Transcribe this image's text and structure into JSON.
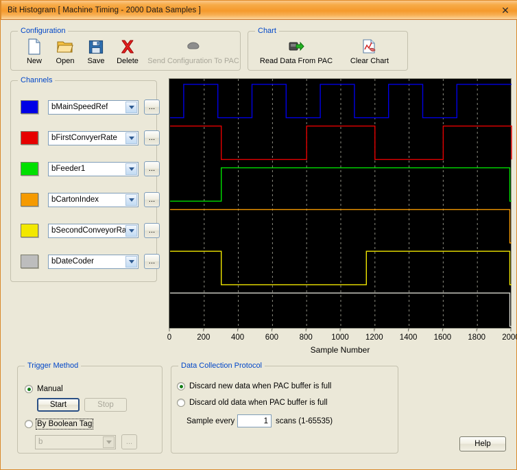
{
  "window": {
    "title": "Bit Histogram [ Machine Timing - 2000 Data Samples ]",
    "close_label": "✕"
  },
  "configuration": {
    "legend": "Configuration",
    "buttons": [
      {
        "label": "New",
        "icon": "new-document-icon",
        "enabled": true
      },
      {
        "label": "Open",
        "icon": "open-folder-icon",
        "enabled": true
      },
      {
        "label": "Save",
        "icon": "floppy-disk-icon",
        "enabled": true
      },
      {
        "label": "Delete",
        "icon": "red-x-icon",
        "enabled": true
      },
      {
        "label": "Send Configuration To PAC",
        "icon": "pac-device-icon",
        "enabled": false
      }
    ]
  },
  "chart_panel": {
    "legend": "Chart",
    "buttons": [
      {
        "label": "Read Data From PAC",
        "icon": "download-arrow-icon",
        "enabled": true
      },
      {
        "label": "Clear Chart",
        "icon": "clear-chart-icon",
        "enabled": true
      }
    ]
  },
  "channels": {
    "legend": "Channels",
    "browse_label": "...",
    "rows": [
      {
        "color": "#0000e6",
        "tag": "bMainSpeedRef"
      },
      {
        "color": "#e60000",
        "tag": "bFirstConvyerRate"
      },
      {
        "color": "#00e000",
        "tag": "bFeeder1"
      },
      {
        "color": "#f59a00",
        "tag": "bCartonIndex"
      },
      {
        "color": "#f2e800",
        "tag": "bSecondConveyorRat‹"
      },
      {
        "color": "#bdbdbd",
        "tag": "bDateCoder"
      }
    ]
  },
  "trigger": {
    "legend": "Trigger Method",
    "manual_label": "Manual",
    "manual_selected": true,
    "start_label": "Start",
    "stop_label": "Stop",
    "stop_enabled": false,
    "boolean_label": "By Boolean Tag",
    "boolean_selected": false,
    "tag_value": "b",
    "browse_label": "..."
  },
  "protocol": {
    "legend": "Data Collection Protocol",
    "discard_new_label": "Discard new data when PAC buffer is full",
    "discard_new_selected": true,
    "discard_old_label": "Discard old data when PAC buffer is full",
    "discard_old_selected": false,
    "sample_prefix": "Sample every",
    "sample_value": "1",
    "sample_suffix": "scans (1-65535)"
  },
  "help": {
    "label": "Help"
  },
  "chart_data": {
    "type": "line",
    "title": "",
    "xlabel": "Sample Number",
    "ylabel": "",
    "xlim": [
      0,
      2000
    ],
    "xticks": [
      0,
      200,
      400,
      600,
      800,
      1000,
      1200,
      1400,
      1600,
      1800,
      2000
    ],
    "xticklabels": [
      "0",
      "200",
      "400",
      "600",
      "800",
      "1000",
      "1200",
      "1400",
      "1600",
      "1800",
      "2000"
    ],
    "grid": true,
    "grid_style": "dashed-vertical",
    "background": "#000000",
    "legend_position": "none",
    "series": [
      {
        "name": "bMainSpeedRef",
        "color": "#0000e6",
        "lane": 0,
        "type": "digital",
        "transitions": [
          {
            "x": 0,
            "v": 0
          },
          {
            "x": 80,
            "v": 1
          },
          {
            "x": 280,
            "v": 0
          },
          {
            "x": 480,
            "v": 1
          },
          {
            "x": 680,
            "v": 0
          },
          {
            "x": 880,
            "v": 1
          },
          {
            "x": 1080,
            "v": 0
          },
          {
            "x": 1280,
            "v": 1
          },
          {
            "x": 1480,
            "v": 0
          },
          {
            "x": 1680,
            "v": 1
          },
          {
            "x": 2000,
            "v": 1
          }
        ]
      },
      {
        "name": "bFirstConvyerRate",
        "color": "#e60000",
        "lane": 1,
        "type": "digital",
        "transitions": [
          {
            "x": 0,
            "v": 1
          },
          {
            "x": 300,
            "v": 0
          },
          {
            "x": 800,
            "v": 1
          },
          {
            "x": 1200,
            "v": 0
          },
          {
            "x": 1600,
            "v": 1
          },
          {
            "x": 2000,
            "v": 0
          }
        ]
      },
      {
        "name": "bFeeder1",
        "color": "#00e000",
        "lane": 2,
        "type": "digital",
        "transitions": [
          {
            "x": 0,
            "v": 0
          },
          {
            "x": 300,
            "v": 1
          },
          {
            "x": 1990,
            "v": 0
          }
        ]
      },
      {
        "name": "bCartonIndex",
        "color": "#f59a00",
        "lane": 3,
        "type": "digital",
        "transitions": [
          {
            "x": 0,
            "v": 1
          },
          {
            "x": 1990,
            "v": 0
          }
        ]
      },
      {
        "name": "bSecondConveyorRate",
        "color": "#f2e800",
        "lane": 4,
        "type": "digital",
        "transitions": [
          {
            "x": 0,
            "v": 1
          },
          {
            "x": 300,
            "v": 0
          },
          {
            "x": 1150,
            "v": 1
          },
          {
            "x": 1990,
            "v": 0
          }
        ]
      },
      {
        "name": "bDateCoder",
        "color": "#d8d8d0",
        "lane": 5,
        "type": "digital",
        "transitions": [
          {
            "x": 0,
            "v": 1
          },
          {
            "x": 1990,
            "v": 0
          }
        ]
      }
    ]
  }
}
